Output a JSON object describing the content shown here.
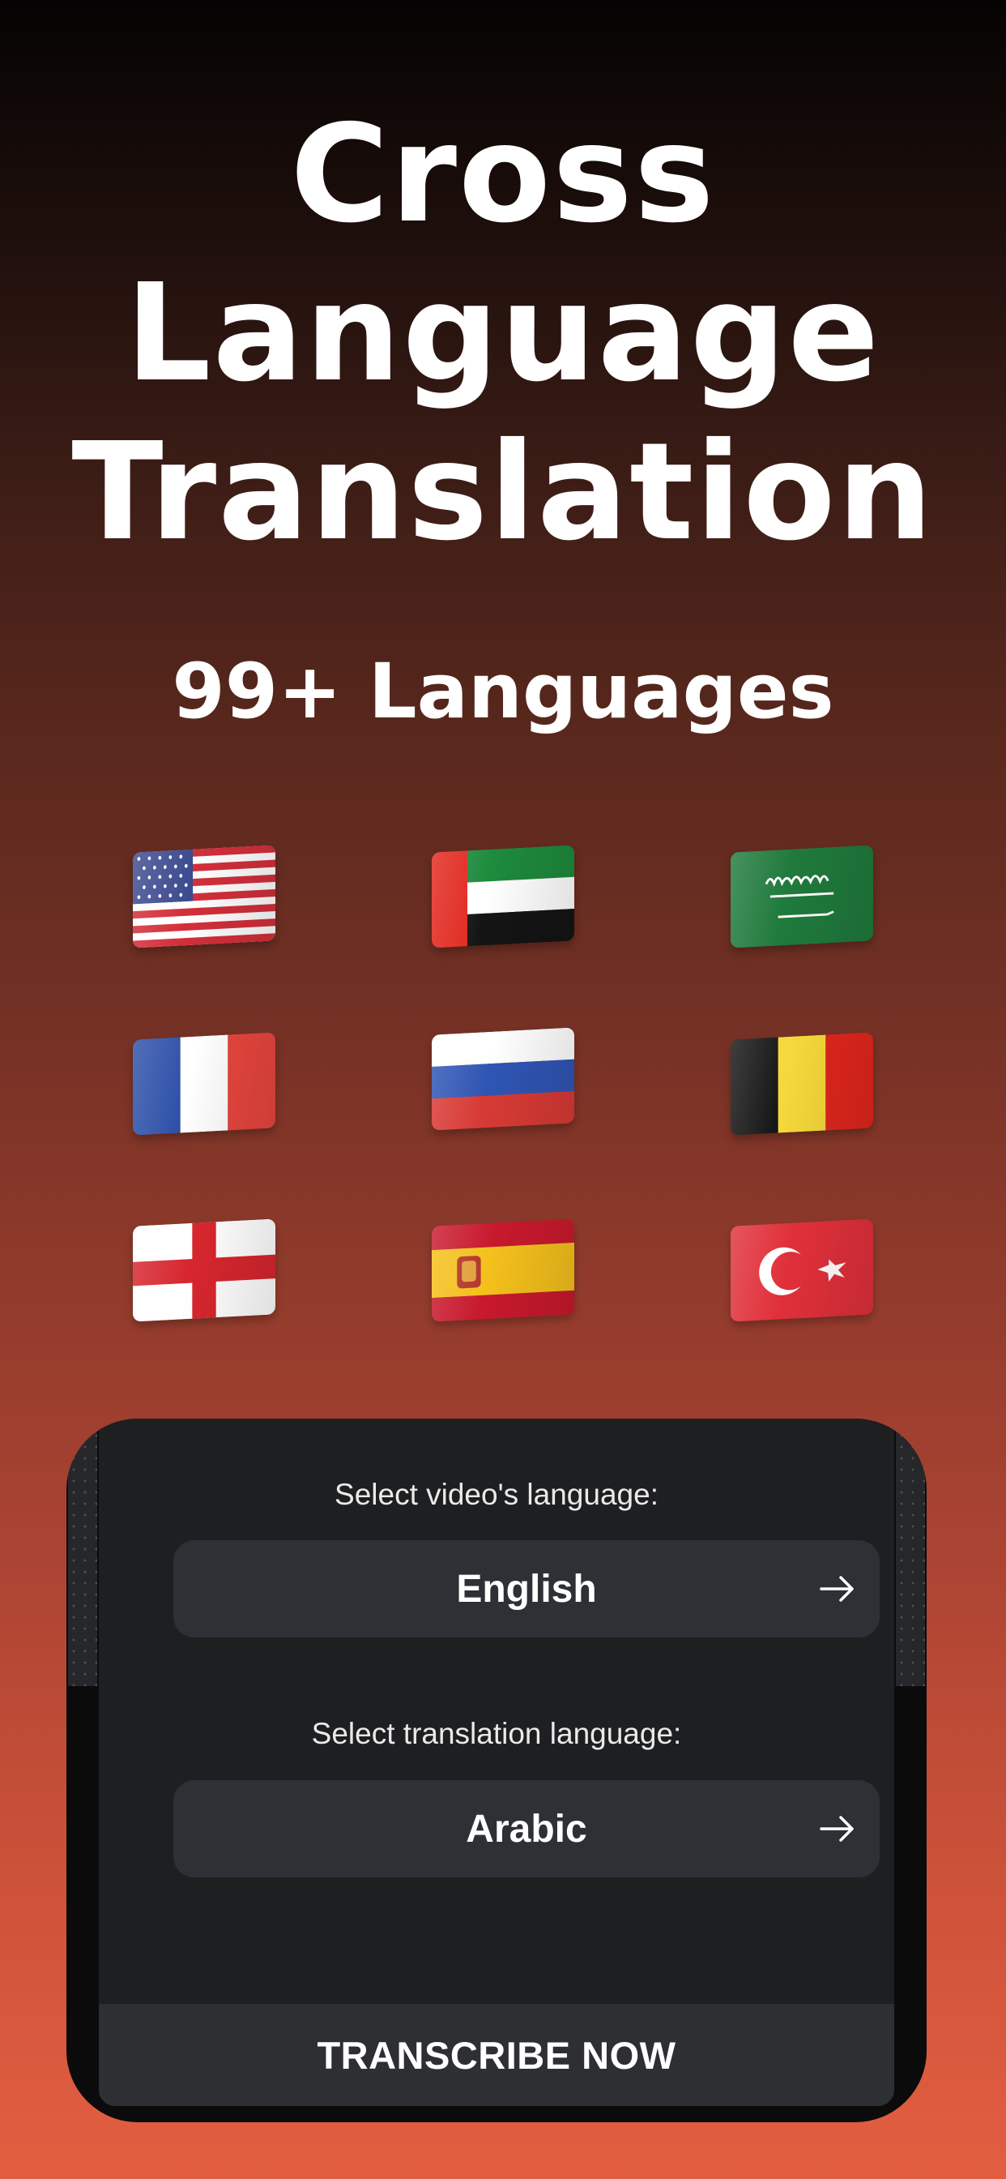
{
  "headline": {
    "line1": "Cross",
    "line2": "Language",
    "line3": "Translation"
  },
  "subheadline": "99+ Languages",
  "flags": [
    {
      "name": "united-states-flag-icon"
    },
    {
      "name": "united-arab-emirates-flag-icon"
    },
    {
      "name": "saudi-arabia-flag-icon"
    },
    {
      "name": "france-flag-icon"
    },
    {
      "name": "russia-flag-icon"
    },
    {
      "name": "belgium-flag-icon"
    },
    {
      "name": "england-flag-icon"
    },
    {
      "name": "spain-flag-icon"
    },
    {
      "name": "turkey-flag-icon"
    }
  ],
  "phone": {
    "video_language": {
      "label": "Select video's language:",
      "value": "English",
      "icon": "arrow-right-icon"
    },
    "translation_language": {
      "label": "Select translation language:",
      "value": "Arabic",
      "icon": "arrow-right-icon"
    },
    "cta_label": "TRANSCRIBE NOW"
  },
  "colors": {
    "background_top": "#050303",
    "background_bottom": "#e35e41",
    "card_bg": "#1e1f21",
    "button_bg": "#2d3034"
  }
}
